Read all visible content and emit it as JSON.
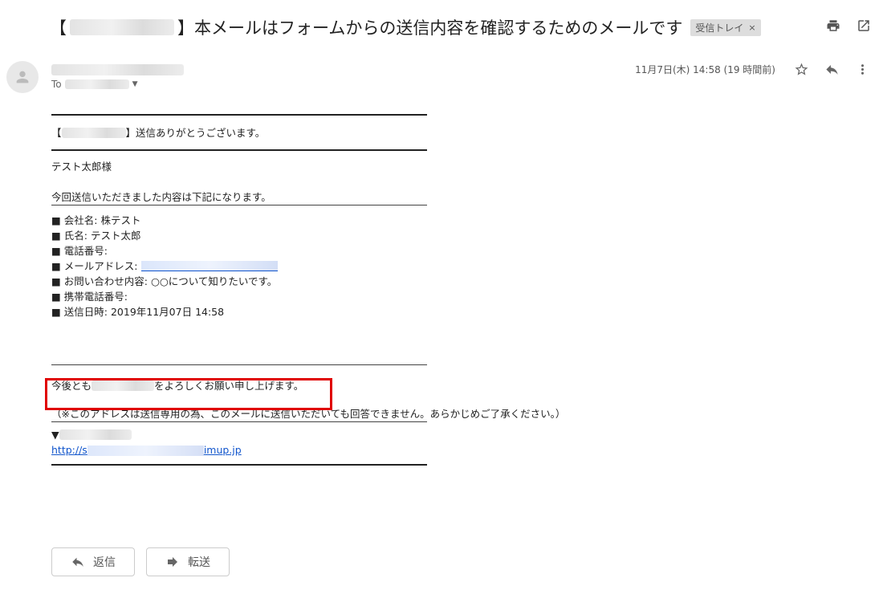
{
  "subject": {
    "prefix": "【",
    "suffix": "】本メールはフォームからの送信内容を確認するためのメールです",
    "label": "受信トレイ",
    "label_close": "×"
  },
  "header": {
    "to_prefix": "To",
    "date": "11月7日(木) 14:58 (19 時間前)"
  },
  "icons": {
    "print": "print-icon",
    "open_new_window": "open-in-new-window-icon",
    "star": "star-icon",
    "reply": "reply-icon",
    "more": "more-vert-icon",
    "avatar": "person-icon",
    "forward": "forward-icon"
  },
  "body": {
    "thanks_prefix": "【",
    "thanks_suffix": "】送信ありがとうございます。",
    "greeting": "テスト太郎様",
    "intro": "今回送信いただきました内容は下記になります。",
    "fields": {
      "company": "■ 会社名: 株テスト",
      "name": "■ 氏名: テスト太郎",
      "phone": "■ 電話番号:",
      "email_label": "■ メールアドレス:",
      "inquiry": "■ お問い合わせ内容: ○○について知りたいです。",
      "mobile": "■ 携帯電話番号:",
      "sent_at": "■ 送信日時: 2019年11月07日 14:58"
    },
    "closing_prefix": "今後とも",
    "closing_suffix": "をよろしくお願い申し上げます。",
    "note": "（※このアドレスは送信専用の為、このメールに送信いただいても回答できません。あらかじめご了承ください。）",
    "triangle": "▼",
    "url_prefix": "http://s",
    "url_suffix": "imup.jp"
  },
  "actions": {
    "reply_label": "返信",
    "forward_label": "転送"
  },
  "colors": {
    "highlight": "#e00000",
    "link": "#1155cc"
  }
}
